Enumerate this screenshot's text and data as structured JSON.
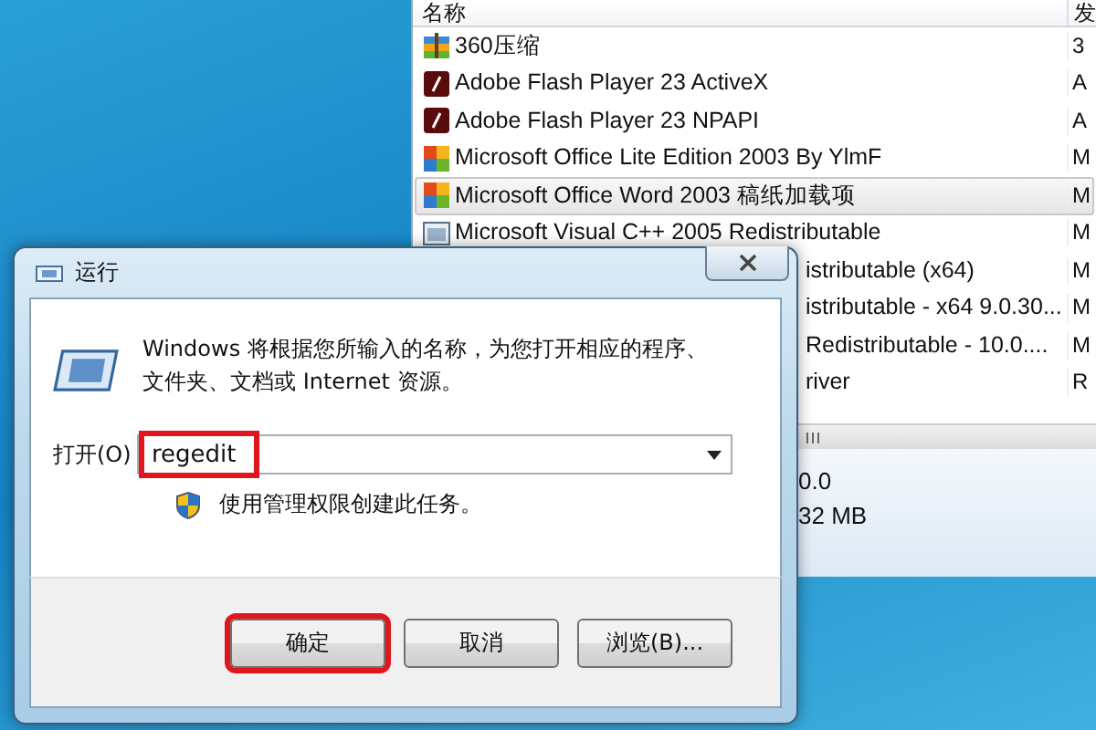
{
  "program_list": {
    "columns": [
      "名称",
      "发"
    ],
    "rows": [
      {
        "kind": "archive",
        "name": "360压缩",
        "column_2": "3",
        "selected": false
      },
      {
        "kind": "flash",
        "name": "Adobe Flash Player 23 ActiveX",
        "column_2": "A",
        "selected": false
      },
      {
        "kind": "flash",
        "name": "Adobe Flash Player 23 NPAPI",
        "column_2": "A",
        "selected": false
      },
      {
        "kind": "office",
        "name": "Microsoft Office Lite Edition 2003 By YlmF",
        "column_2": "M",
        "selected": false
      },
      {
        "kind": "office",
        "name": "Microsoft Office Word 2003 稿纸加载项",
        "column_2": "M",
        "selected": true
      },
      {
        "kind": "installer",
        "name": "Microsoft Visual C++ 2005 Redistributable",
        "column_2": "M",
        "selected": false
      },
      {
        "kind": "covered",
        "name": "istributable (x64)",
        "column_2": "M",
        "selected": false
      },
      {
        "kind": "covered",
        "name": "istributable - x64 9.0.30...",
        "column_2": "M",
        "selected": false
      },
      {
        "kind": "covered",
        "name": "Redistributable - 10.0....",
        "column_2": "M",
        "selected": false
      },
      {
        "kind": "covered",
        "name": "river",
        "column_2": "R",
        "selected": false
      }
    ],
    "details": [
      "0.0",
      "32 MB"
    ]
  },
  "dialog": {
    "title": "运行",
    "description": "Windows 将根据您所输入的名称，为您打开相应的程序、文件夹、文档或 Internet 资源。",
    "field_label": "打开(O)",
    "field_value": "regedit",
    "field_highlighted": true,
    "admin_note": "使用管理权限创建此任务。",
    "buttons": [
      {
        "label": "确定",
        "highlighted": true
      },
      {
        "label": "取消",
        "highlighted": false
      },
      {
        "label": "浏览(B)...",
        "highlighted": false
      }
    ]
  }
}
